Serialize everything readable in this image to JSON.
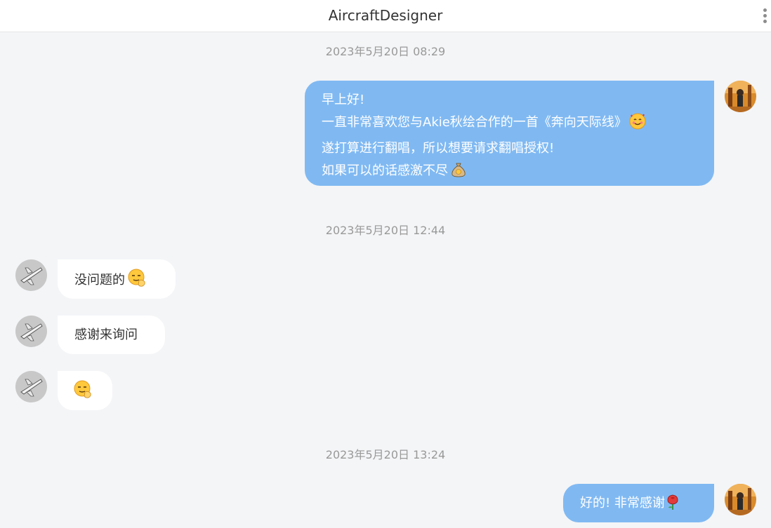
{
  "header": {
    "title": "AircraftDesigner",
    "menu_icon": "more-vertical-icon"
  },
  "timestamps": [
    "2023年5月20日 08:29",
    "2023年5月20日 12:44",
    "2023年5月20日 13:24"
  ],
  "messages": {
    "m1": {
      "sender": "me",
      "lines": [
        "早上好!",
        "一直非常喜欢您与Akie秋绘合作的一首《奔向天际线》",
        "遂打算进行翻唱，所以想要请求翻唱授权!",
        "如果可以的话感激不尽"
      ],
      "emojis": [
        "smiling-face-with-hearts-emoji",
        "money-bag-emoji"
      ]
    },
    "m2": {
      "sender": "them",
      "text": "没问题的",
      "emoji": "shushing-face-emoji"
    },
    "m3": {
      "sender": "them",
      "text": "感谢来询问"
    },
    "m4": {
      "sender": "them",
      "emoji": "shushing-face-emoji"
    },
    "m5": {
      "sender": "me",
      "text": "好的! 非常感谢",
      "emoji": "rose-emoji"
    }
  },
  "colors": {
    "my_bubble": "#80b9f2",
    "their_bubble": "#ffffff",
    "background": "#f4f5f7",
    "timestamp": "#999999"
  }
}
